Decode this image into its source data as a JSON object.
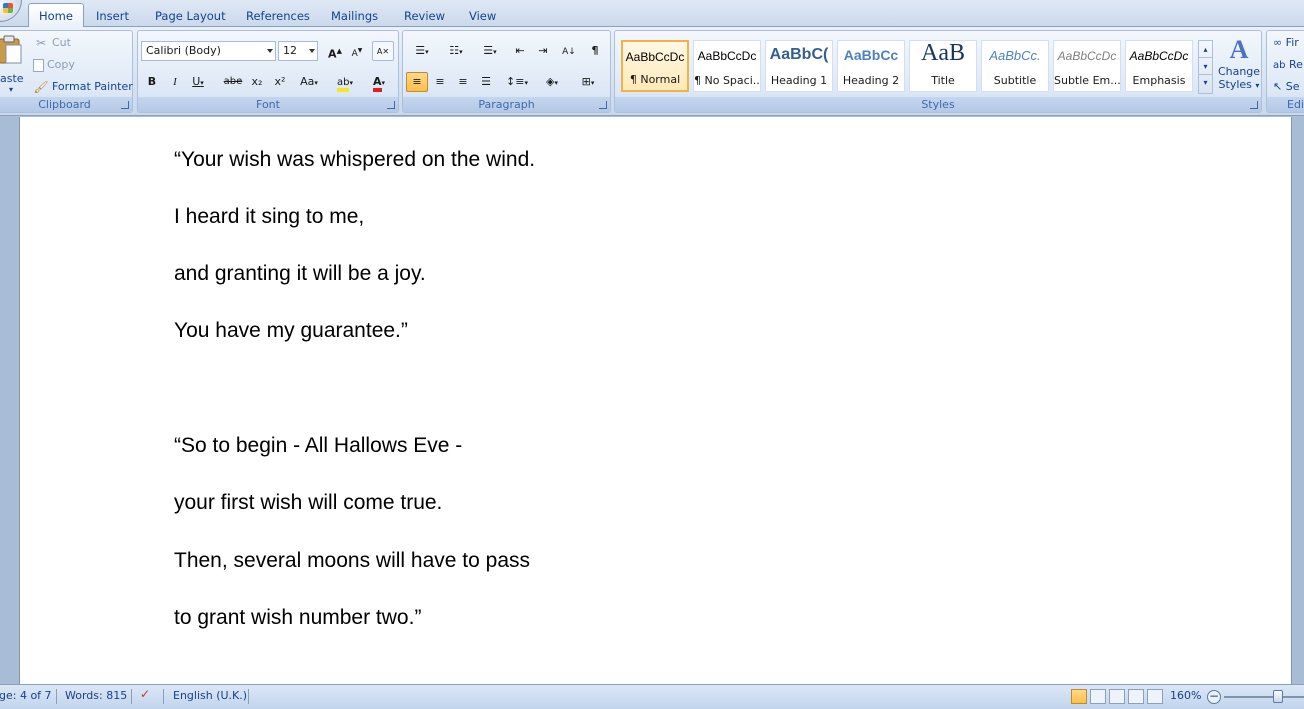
{
  "tabs": [
    "Home",
    "Insert",
    "Page Layout",
    "References",
    "Mailings",
    "Review",
    "View"
  ],
  "active_tab": "Home",
  "clipboard": {
    "paste_label": "aste",
    "cut_label": "Cut",
    "copy_label": "Copy",
    "format_painter_label": "Format Painter",
    "group_label": "Clipboard"
  },
  "font": {
    "font_name": "Calibri (Body)",
    "font_size": "12",
    "bold": "B",
    "italic": "I",
    "underline": "U",
    "strike": "abe",
    "subscript": "x₂",
    "superscript": "x²",
    "change_case": "Aa",
    "grow": "A",
    "shrink": "A",
    "font_color": "#e02020",
    "highlight_color": "#f7e81a",
    "group_label": "Font"
  },
  "paragraph": {
    "pilcrow": "¶",
    "group_label": "Paragraph"
  },
  "styles": {
    "items": [
      {
        "sample": "AaBbCcDc",
        "name": "¶ Normal"
      },
      {
        "sample": "AaBbCcDc",
        "name": "¶ No Spaci..."
      },
      {
        "sample": "AaBbC(",
        "name": "Heading 1"
      },
      {
        "sample": "AaBbCc",
        "name": "Heading 2"
      },
      {
        "sample": "AaB",
        "name": "Title"
      },
      {
        "sample": "AaBbCc.",
        "name": "Subtitle"
      },
      {
        "sample": "AaBbCcDc",
        "name": "Subtle Em..."
      },
      {
        "sample": "AaBbCcDc",
        "name": "Emphasis"
      }
    ],
    "change_styles_line1": "Change",
    "change_styles_line2": "Styles",
    "group_label": "Styles"
  },
  "editing": {
    "find_label": "Fir",
    "replace_label": "Re",
    "select_label": "Se",
    "group_label": "Edit"
  },
  "document": {
    "lines": [
      "“Your wish was whispered on the wind.",
      "I heard it sing to me,",
      "and granting it will be a joy.",
      "You have my guarantee.”",
      "",
      "“So to begin - All Hallows Eve -",
      "your first wish will come true.",
      "Then, several moons will have to pass",
      "to grant wish number two.”"
    ]
  },
  "status": {
    "page": "ge: 4 of 7",
    "words": "Words: 815",
    "language": "English (U.K.)",
    "zoom": "160%",
    "zoom_minus": "−"
  }
}
